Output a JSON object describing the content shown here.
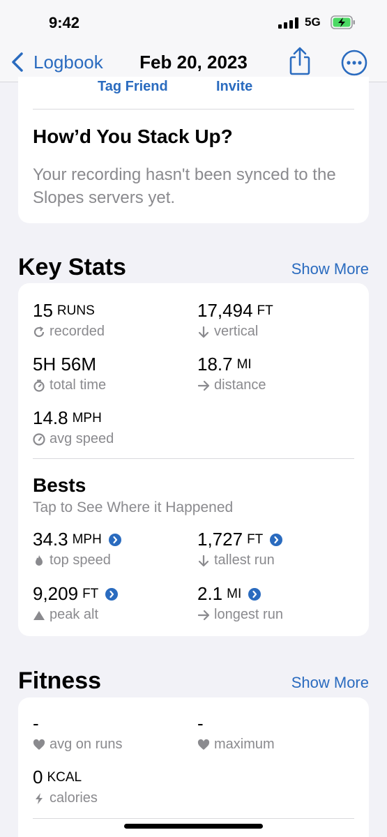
{
  "status_bar": {
    "time": "9:42",
    "network": "5G"
  },
  "nav": {
    "back_label": "Logbook",
    "title": "Feb 20, 2023"
  },
  "friends": {
    "tag_friend": "Tag Friend",
    "invite": "Invite"
  },
  "stack_up": {
    "title": "How’d You Stack Up?",
    "message": "Your recording hasn't been synced to the Slopes servers yet."
  },
  "key_stats": {
    "title": "Key Stats",
    "show_more": "Show More",
    "items": [
      {
        "value": "15",
        "unit": "RUNS",
        "label": "recorded",
        "icon": "refresh-icon"
      },
      {
        "value": "17,494",
        "unit": "FT",
        "label": "vertical",
        "icon": "arrow-down-icon"
      },
      {
        "value": "5H 56M",
        "unit": "",
        "label": "total time",
        "icon": "stopwatch-icon"
      },
      {
        "value": "18.7",
        "unit": "MI",
        "label": "distance",
        "icon": "arrow-right-icon"
      },
      {
        "value": "14.8",
        "unit": "MPH",
        "label": "avg speed",
        "icon": "speedometer-icon"
      }
    ]
  },
  "bests": {
    "title": "Bests",
    "subtitle": "Tap to See Where it Happened",
    "items": [
      {
        "value": "34.3",
        "unit": "MPH",
        "label": "top speed",
        "icon": "flame-icon"
      },
      {
        "value": "1,727",
        "unit": "FT",
        "label": "tallest run",
        "icon": "arrow-down-icon"
      },
      {
        "value": "9,209",
        "unit": "FT",
        "label": "peak alt",
        "icon": "mountain-icon"
      },
      {
        "value": "2.1",
        "unit": "MI",
        "label": "longest run",
        "icon": "arrow-right-icon"
      }
    ]
  },
  "fitness": {
    "title": "Fitness",
    "show_more": "Show More",
    "items": [
      {
        "value": "-",
        "unit": "",
        "label": "avg on runs",
        "icon": "heart-icon"
      },
      {
        "value": "-",
        "unit": "",
        "label": "maximum",
        "icon": "heart-icon"
      },
      {
        "value": "0",
        "unit": "KCAL",
        "label": "calories",
        "icon": "bolt-icon"
      }
    ]
  },
  "colors": {
    "accent": "#2a6bbf",
    "background": "#f2f2f7",
    "muted": "#8a8a8e",
    "battery": "#4cd964"
  }
}
